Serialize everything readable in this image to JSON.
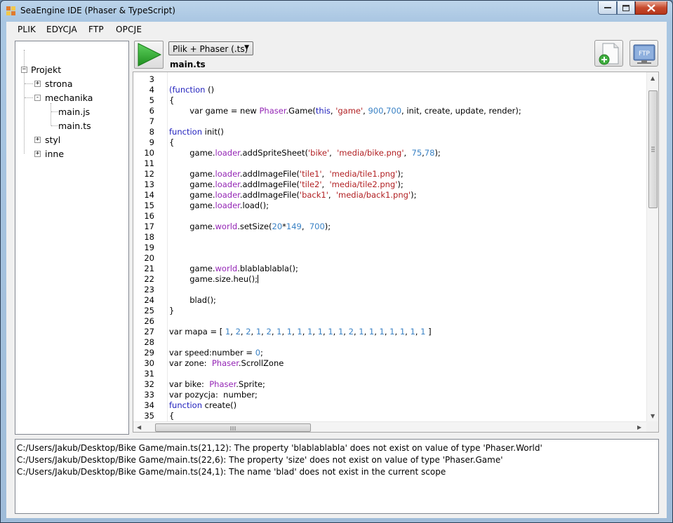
{
  "window": {
    "title": "SeaEngine IDE (Phaser & TypeScript)"
  },
  "menu": [
    "PLIK",
    "EDYCJA",
    "FTP",
    "OPCJE"
  ],
  "tree": {
    "root": "Projekt",
    "items": [
      {
        "label": "strona",
        "expander": "+"
      },
      {
        "label": "mechanika",
        "expander": "-"
      },
      {
        "label": "main.js"
      },
      {
        "label": "main.ts"
      },
      {
        "label": "styl",
        "expander": "+"
      },
      {
        "label": "inne",
        "expander": "+"
      }
    ]
  },
  "toolbar": {
    "run_icon": "play-icon",
    "filetype_selected": "Plik + Phaser (.ts)",
    "new_file_icon": "new-file-icon",
    "ftp_label": "FTP"
  },
  "editor": {
    "filename": "main.ts",
    "caret_line": 22,
    "lines": [
      {
        "n": "3",
        "tokens": []
      },
      {
        "n": "4",
        "tokens": [
          [
            "kw",
            "(function"
          ],
          [
            "p",
            " ()"
          ]
        ]
      },
      {
        "n": "5",
        "tokens": [
          [
            "p",
            "{"
          ]
        ]
      },
      {
        "n": "6",
        "tokens": [
          [
            "p",
            "        var game = new "
          ],
          [
            "cls",
            "Phaser"
          ],
          [
            "p",
            ".Game("
          ],
          [
            "kw",
            "this"
          ],
          [
            "p",
            ", "
          ],
          [
            "str",
            "'game'"
          ],
          [
            "p",
            ", "
          ],
          [
            "num",
            "900"
          ],
          [
            "p",
            ","
          ],
          [
            "num",
            "700"
          ],
          [
            "p",
            ", init, create, update, render);"
          ]
        ]
      },
      {
        "n": "7",
        "tokens": []
      },
      {
        "n": "8",
        "tokens": [
          [
            "kw",
            "function"
          ],
          [
            "p",
            " init()"
          ]
        ]
      },
      {
        "n": "9",
        "tokens": [
          [
            "p",
            "{"
          ]
        ]
      },
      {
        "n": "10",
        "tokens": [
          [
            "p",
            "        game."
          ],
          [
            "prop",
            "loader"
          ],
          [
            "p",
            ".addSpriteSheet("
          ],
          [
            "str",
            "'bike'"
          ],
          [
            "p",
            ",  "
          ],
          [
            "str",
            "'media/bike.png'"
          ],
          [
            "p",
            ",  "
          ],
          [
            "num",
            "75"
          ],
          [
            "p",
            ","
          ],
          [
            "num",
            "78"
          ],
          [
            "p",
            ");"
          ]
        ]
      },
      {
        "n": "11",
        "tokens": []
      },
      {
        "n": "12",
        "tokens": [
          [
            "p",
            "        game."
          ],
          [
            "prop",
            "loader"
          ],
          [
            "p",
            ".addImageFile("
          ],
          [
            "str",
            "'tile1'"
          ],
          [
            "p",
            ",  "
          ],
          [
            "str",
            "'media/tile1.png'"
          ],
          [
            "p",
            ");"
          ]
        ]
      },
      {
        "n": "13",
        "tokens": [
          [
            "p",
            "        game."
          ],
          [
            "prop",
            "loader"
          ],
          [
            "p",
            ".addImageFile("
          ],
          [
            "str",
            "'tile2'"
          ],
          [
            "p",
            ",  "
          ],
          [
            "str",
            "'media/tile2.png'"
          ],
          [
            "p",
            ");"
          ]
        ]
      },
      {
        "n": "14",
        "tokens": [
          [
            "p",
            "        game."
          ],
          [
            "prop",
            "loader"
          ],
          [
            "p",
            ".addImageFile("
          ],
          [
            "str",
            "'back1'"
          ],
          [
            "p",
            ",  "
          ],
          [
            "str",
            "'media/back1.png'"
          ],
          [
            "p",
            ");"
          ]
        ]
      },
      {
        "n": "15",
        "tokens": [
          [
            "p",
            "        game."
          ],
          [
            "prop",
            "loader"
          ],
          [
            "p",
            ".load();"
          ]
        ]
      },
      {
        "n": "16",
        "tokens": []
      },
      {
        "n": "17",
        "tokens": [
          [
            "p",
            "        game."
          ],
          [
            "prop",
            "world"
          ],
          [
            "p",
            ".setSize("
          ],
          [
            "num",
            "20"
          ],
          [
            "p",
            "*"
          ],
          [
            "num",
            "149"
          ],
          [
            "p",
            ",  "
          ],
          [
            "num",
            "700"
          ],
          [
            "p",
            ");"
          ]
        ]
      },
      {
        "n": "18",
        "tokens": []
      },
      {
        "n": "19",
        "tokens": []
      },
      {
        "n": "20",
        "tokens": []
      },
      {
        "n": "21",
        "tokens": [
          [
            "p",
            "        game."
          ],
          [
            "prop",
            "world"
          ],
          [
            "p",
            ".blablablabla();"
          ]
        ]
      },
      {
        "n": "22",
        "tokens": [
          [
            "p",
            "        game.size.heu();"
          ]
        ]
      },
      {
        "n": "23",
        "tokens": []
      },
      {
        "n": "24",
        "tokens": [
          [
            "p",
            "        blad();"
          ]
        ]
      },
      {
        "n": "25",
        "tokens": [
          [
            "p",
            "}"
          ]
        ]
      },
      {
        "n": "26",
        "tokens": []
      },
      {
        "n": "27",
        "tokens": [
          [
            "p",
            "var mapa = [ "
          ],
          [
            "num",
            "1"
          ],
          [
            "p",
            ", "
          ],
          [
            "num",
            "2"
          ],
          [
            "p",
            ", "
          ],
          [
            "num",
            "2"
          ],
          [
            "p",
            ", "
          ],
          [
            "num",
            "1"
          ],
          [
            "p",
            ", "
          ],
          [
            "num",
            "2"
          ],
          [
            "p",
            ", "
          ],
          [
            "num",
            "1"
          ],
          [
            "p",
            ", "
          ],
          [
            "num",
            "1"
          ],
          [
            "p",
            ", "
          ],
          [
            "num",
            "1"
          ],
          [
            "p",
            ", "
          ],
          [
            "num",
            "1"
          ],
          [
            "p",
            ", "
          ],
          [
            "num",
            "1"
          ],
          [
            "p",
            ", "
          ],
          [
            "num",
            "1"
          ],
          [
            "p",
            ", "
          ],
          [
            "num",
            "1"
          ],
          [
            "p",
            ", "
          ],
          [
            "num",
            "2"
          ],
          [
            "p",
            ", "
          ],
          [
            "num",
            "1"
          ],
          [
            "p",
            ", "
          ],
          [
            "num",
            "1"
          ],
          [
            "p",
            ", "
          ],
          [
            "num",
            "1"
          ],
          [
            "p",
            ", "
          ],
          [
            "num",
            "1"
          ],
          [
            "p",
            ", "
          ],
          [
            "num",
            "1"
          ],
          [
            "p",
            ", "
          ],
          [
            "num",
            "1"
          ],
          [
            "p",
            ", "
          ],
          [
            "num",
            "1"
          ],
          [
            "p",
            " ]"
          ]
        ]
      },
      {
        "n": "28",
        "tokens": []
      },
      {
        "n": "29",
        "tokens": [
          [
            "p",
            "var speed:number = "
          ],
          [
            "num",
            "0"
          ],
          [
            "p",
            ";"
          ]
        ]
      },
      {
        "n": "30",
        "tokens": [
          [
            "p",
            "var zone:  "
          ],
          [
            "cls",
            "Phaser"
          ],
          [
            "p",
            ".ScrollZone"
          ]
        ]
      },
      {
        "n": "31",
        "tokens": []
      },
      {
        "n": "32",
        "tokens": [
          [
            "p",
            "var bike:  "
          ],
          [
            "cls",
            "Phaser"
          ],
          [
            "p",
            ".Sprite;"
          ]
        ]
      },
      {
        "n": "33",
        "tokens": [
          [
            "p",
            "var pozycja:  number;"
          ]
        ]
      },
      {
        "n": "34",
        "tokens": [
          [
            "kw",
            "function"
          ],
          [
            "p",
            " create()"
          ]
        ]
      },
      {
        "n": "35",
        "tokens": [
          [
            "p",
            "{"
          ]
        ]
      }
    ]
  },
  "output": [
    "C:/Users/Jakub/Desktop/Bike Game/main.ts(21,12): The property 'blablablabla' does not exist on value of type 'Phaser.World'",
    "C:/Users/Jakub/Desktop/Bike Game/main.ts(22,6): The property 'size' does not exist on value of type 'Phaser.Game'",
    "C:/Users/Jakub/Desktop/Bike Game/main.ts(24,1): The name 'blad' does not exist in the current scope"
  ],
  "colors": {
    "keyword": "#1f1fbd",
    "string": "#b11f22",
    "number": "#3a82c5",
    "class": "#9425b5",
    "run": "#2aa52a",
    "close": "#c74a2d"
  }
}
